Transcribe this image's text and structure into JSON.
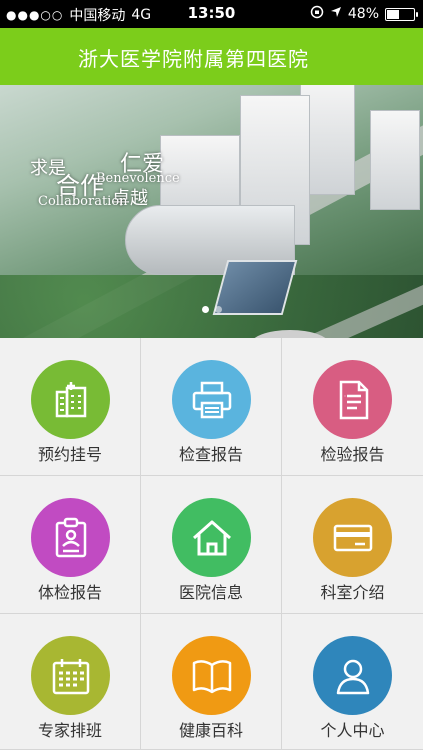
{
  "status_bar": {
    "signal": "●●●○○",
    "carrier": "中国移动",
    "network": "4G",
    "time": "13:50",
    "battery_percent": "48%",
    "battery_level": 0.48
  },
  "header": {
    "title": "浙大医学院附属第四医院"
  },
  "banner": {
    "slogan": {
      "qiushi": "求是",
      "hezuo": "合作",
      "renai": "仁爱",
      "benevolence": "Benevolence",
      "zhuoyue": "卓越",
      "collaboration": "Collaboration"
    },
    "pages": 2,
    "active_page": 1
  },
  "menu": [
    {
      "label": "预约挂号",
      "icon": "hospital-building-icon",
      "color": "#78bb35"
    },
    {
      "label": "检查报告",
      "icon": "printer-icon",
      "color": "#5ab4de"
    },
    {
      "label": "检验报告",
      "icon": "document-report-icon",
      "color": "#d85d82"
    },
    {
      "label": "体检报告",
      "icon": "clipboard-person-icon",
      "color": "#c14bc2"
    },
    {
      "label": "医院信息",
      "icon": "home-icon",
      "color": "#41bd62"
    },
    {
      "label": "科室介绍",
      "icon": "card-icon",
      "color": "#d8a22f"
    },
    {
      "label": "专家排班",
      "icon": "calendar-icon",
      "color": "#a8b732"
    },
    {
      "label": "健康百科",
      "icon": "book-icon",
      "color": "#f09a13"
    },
    {
      "label": "个人中心",
      "icon": "user-icon",
      "color": "#2f86bb"
    }
  ]
}
